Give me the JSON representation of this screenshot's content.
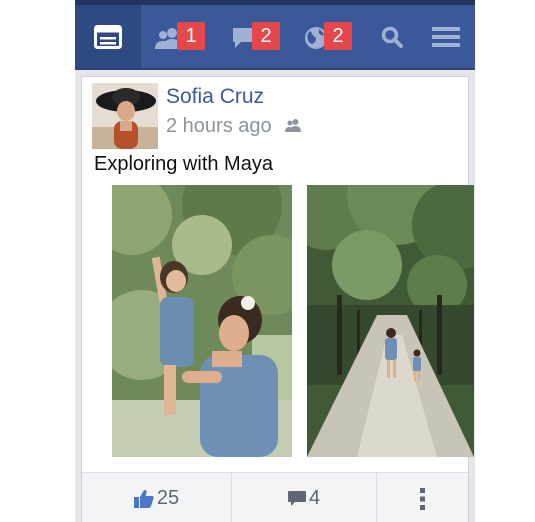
{
  "nav": {
    "friends_badge": "1",
    "messages_badge": "2",
    "notifications_badge": "2"
  },
  "post": {
    "author": "Sofia Cruz",
    "timestamp": "2 hours ago",
    "caption": "Exploring with Maya",
    "likes": "25",
    "comments": "4"
  },
  "colors": {
    "brand_blue": "#3b5998",
    "badge_red": "#e5474a",
    "like_blue": "#4a76c9"
  },
  "icons": [
    "feed-icon",
    "friends-icon",
    "messages-icon",
    "globe-icon",
    "search-icon",
    "menu-icon",
    "audience-icon",
    "like-icon",
    "comment-icon",
    "more-icon"
  ]
}
